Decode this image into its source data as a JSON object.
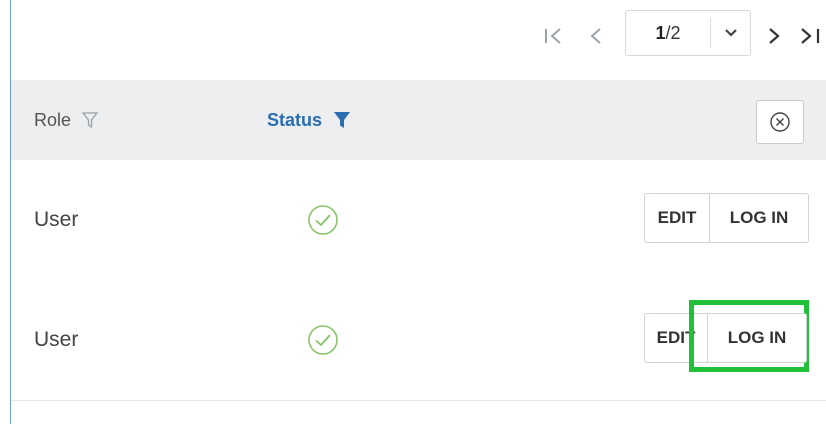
{
  "pagination": {
    "first_symbol": "|<",
    "prev_symbol": "<",
    "current": "1",
    "separator": "/",
    "total": "2",
    "next_symbol": ">",
    "last_symbol": ">|"
  },
  "table": {
    "columns": {
      "role": "Role",
      "status": "Status"
    },
    "rows": [
      {
        "role": "User",
        "status": "active",
        "edit_label": "EDIT",
        "login_label": "LOG IN"
      },
      {
        "role": "User",
        "status": "active",
        "edit_label": "EDIT",
        "login_label": "LOG IN"
      }
    ]
  },
  "colors": {
    "accent": "#2a6db0",
    "status_ok": "#8ac46a",
    "highlight": "#22c038"
  },
  "icons": {
    "first_page": "first-page-icon",
    "prev_page": "prev-page-icon",
    "dropdown": "chevron-down-icon",
    "next_page": "next-page-icon",
    "last_page": "last-page-icon",
    "role_filter": "filter-outline-icon",
    "status_filter": "filter-filled-icon",
    "clear_filters": "clear-circle-icon",
    "status_ok": "check-circle-icon"
  }
}
